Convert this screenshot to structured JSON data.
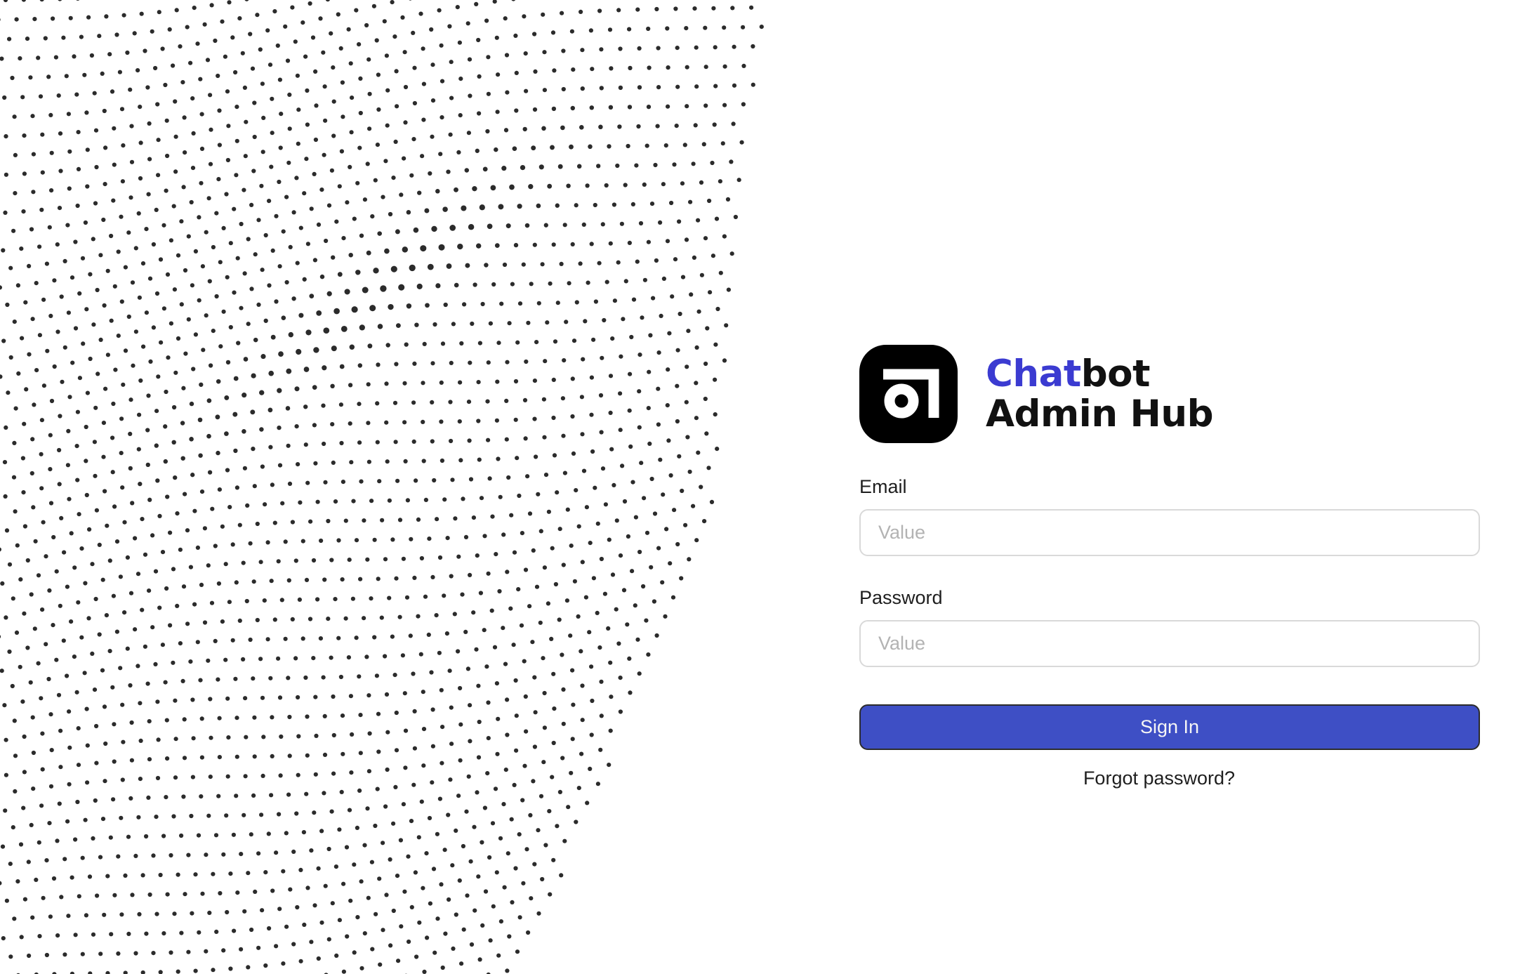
{
  "brand": {
    "name_accent": "Chat",
    "name_rest": "bot",
    "subtitle": "Admin Hub",
    "accent_color": "#3b3bd1",
    "logo_icon": "ring-corner-logo-icon"
  },
  "login": {
    "email_label": "Email",
    "email_placeholder": "Value",
    "password_label": "Password",
    "password_placeholder": "Value",
    "signin_label": "Sign In",
    "forgot_label": "Forgot password?",
    "button_color": "#3e4fc5"
  },
  "background": {
    "pattern": "wavy-halftone-dot-field"
  }
}
